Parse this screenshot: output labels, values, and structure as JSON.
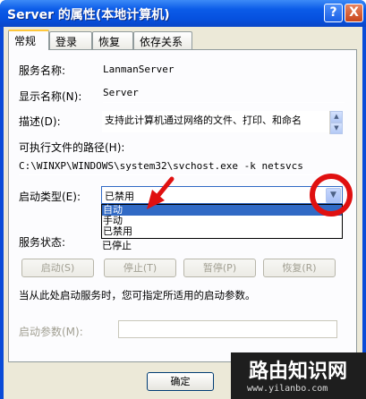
{
  "window": {
    "title": "Server 的属性(本地计算机)",
    "help_label": "?",
    "close_label": "X"
  },
  "tabs": [
    {
      "label": "常规",
      "active": true
    },
    {
      "label": "登录",
      "active": false
    },
    {
      "label": "恢复",
      "active": false
    },
    {
      "label": "依存关系",
      "active": false
    }
  ],
  "general": {
    "service_name_label": "服务名称:",
    "service_name_value": "LanmanServer",
    "display_name_label": "显示名称(N):",
    "display_name_value": "Server",
    "description_label": "描述(D):",
    "description_value": "支持此计算机通过网络的文件、打印、和命名",
    "exe_path_label": "可执行文件的路径(H):",
    "exe_path_value": "C:\\WINXP\\WINDOWS\\system32\\svchost.exe -k netsvcs",
    "startup_type_label": "启动类型(E):",
    "startup_type_value": "已禁用",
    "startup_options": [
      "自动",
      "手动",
      "已禁用"
    ],
    "startup_selected_option": "自动",
    "service_status_label": "服务状态:",
    "service_status_value": "已停止",
    "buttons": {
      "start": "启动(S)",
      "stop": "停止(T)",
      "pause": "暂停(P)",
      "resume": "恢复(R)"
    },
    "hint_text": "当从此处启动服务时，您可指定所适用的启动参数。",
    "start_params_label": "启动参数(M):",
    "start_params_value": ""
  },
  "footer": {
    "ok_label": "确定"
  },
  "watermark": {
    "title": "路由知识网",
    "url": "www.yilanbo.com"
  },
  "annotation": {
    "color": "#e01010"
  },
  "colors": {
    "titlebar": "#0651df",
    "dialog_bg": "#ece9d8",
    "selection": "#316ac5"
  }
}
